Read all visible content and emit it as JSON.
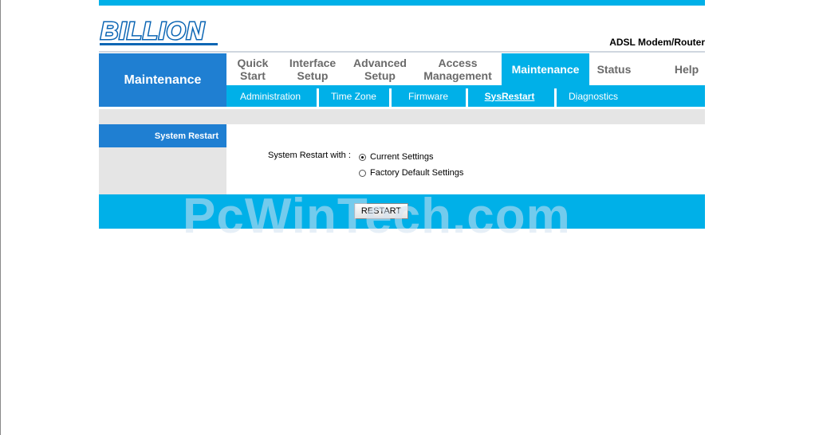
{
  "brand": {
    "logo_text": "BILLION",
    "product": "ADSL Modem/Router",
    "logo_color": "#0c66b4"
  },
  "section_title": "Maintenance",
  "menu": [
    {
      "line1": "Quick",
      "line2": "Start"
    },
    {
      "line1": "Interface",
      "line2": "Setup"
    },
    {
      "line1": "Advanced",
      "line2": "Setup"
    },
    {
      "line1": "Access",
      "line2": "Management"
    },
    {
      "line1": "Maintenance",
      "line2": "",
      "active": true
    },
    {
      "line1": "Status",
      "line2": ""
    },
    {
      "line1": "Help",
      "line2": ""
    }
  ],
  "submenu": [
    {
      "label": "Administration"
    },
    {
      "label": "Time Zone"
    },
    {
      "label": "Firmware"
    },
    {
      "label": "SysRestart",
      "active": true
    },
    {
      "label": "Diagnostics"
    }
  ],
  "panel": {
    "title": "System Restart",
    "form_label": "System Restart with :",
    "options": [
      {
        "label": "Current Settings",
        "checked": true
      },
      {
        "label": "Factory Default Settings",
        "checked": false
      }
    ],
    "button": "RESTART"
  },
  "watermark": "PcWinTech.com",
  "colors": {
    "accent": "#00b0e8",
    "section_blue": "#1f7fd2",
    "panel_gray": "#e5e5e5"
  }
}
